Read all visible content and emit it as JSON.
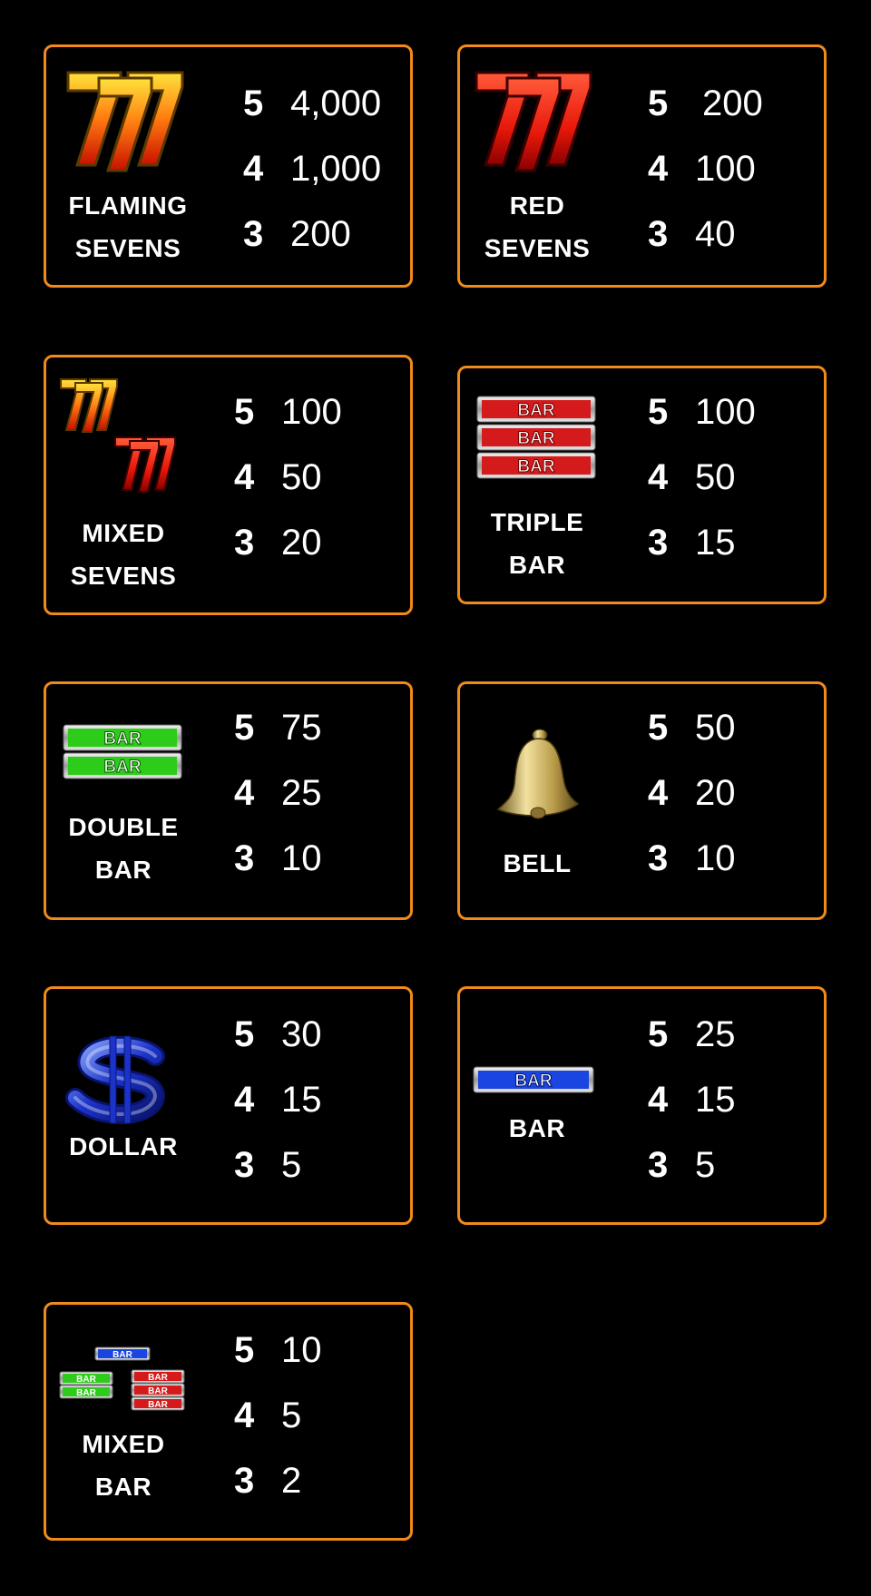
{
  "symbols": [
    {
      "name_line1": "FLAMING",
      "name_line2": "SEVENS",
      "icon": "flaming-sevens-icon",
      "pays": [
        {
          "count": "5",
          "value": "4,000"
        },
        {
          "count": "4",
          "value": "1,000"
        },
        {
          "count": "3",
          "value": "200"
        }
      ]
    },
    {
      "name_line1": "RED",
      "name_line2": "SEVENS",
      "icon": "red-sevens-icon",
      "pays": [
        {
          "count": "5",
          "value": "200"
        },
        {
          "count": "4",
          "value": "100"
        },
        {
          "count": "3",
          "value": "40"
        }
      ]
    },
    {
      "name_line1": "MIXED",
      "name_line2": "SEVENS",
      "icon": "mixed-sevens-icon",
      "pays": [
        {
          "count": "5",
          "value": "100"
        },
        {
          "count": "4",
          "value": "50"
        },
        {
          "count": "3",
          "value": "20"
        }
      ]
    },
    {
      "name_line1": "TRIPLE",
      "name_line2": "BAR",
      "icon": "triple-bar-icon",
      "pays": [
        {
          "count": "5",
          "value": "100"
        },
        {
          "count": "4",
          "value": "50"
        },
        {
          "count": "3",
          "value": "15"
        }
      ]
    },
    {
      "name_line1": "DOUBLE",
      "name_line2": "BAR",
      "icon": "double-bar-icon",
      "pays": [
        {
          "count": "5",
          "value": "75"
        },
        {
          "count": "4",
          "value": "25"
        },
        {
          "count": "3",
          "value": "10"
        }
      ]
    },
    {
      "name_line1": "BELL",
      "name_line2": "",
      "icon": "bell-icon",
      "pays": [
        {
          "count": "5",
          "value": "50"
        },
        {
          "count": "4",
          "value": "20"
        },
        {
          "count": "3",
          "value": "10"
        }
      ]
    },
    {
      "name_line1": "DOLLAR",
      "name_line2": "",
      "icon": "dollar-icon",
      "pays": [
        {
          "count": "5",
          "value": "30"
        },
        {
          "count": "4",
          "value": "15"
        },
        {
          "count": "3",
          "value": "5"
        }
      ]
    },
    {
      "name_line1": "BAR",
      "name_line2": "",
      "icon": "single-bar-icon",
      "pays": [
        {
          "count": "5",
          "value": "25"
        },
        {
          "count": "4",
          "value": "15"
        },
        {
          "count": "3",
          "value": "5"
        }
      ]
    },
    {
      "name_line1": "MIXED",
      "name_line2": "BAR",
      "icon": "mixed-bar-icon",
      "pays": [
        {
          "count": "5",
          "value": "10"
        },
        {
          "count": "4",
          "value": "5"
        },
        {
          "count": "3",
          "value": "2"
        }
      ]
    }
  ],
  "icon_labels": {
    "bar": "BAR"
  },
  "colors": {
    "border": "#f08a1a",
    "background": "#000000",
    "text": "#ffffff"
  }
}
